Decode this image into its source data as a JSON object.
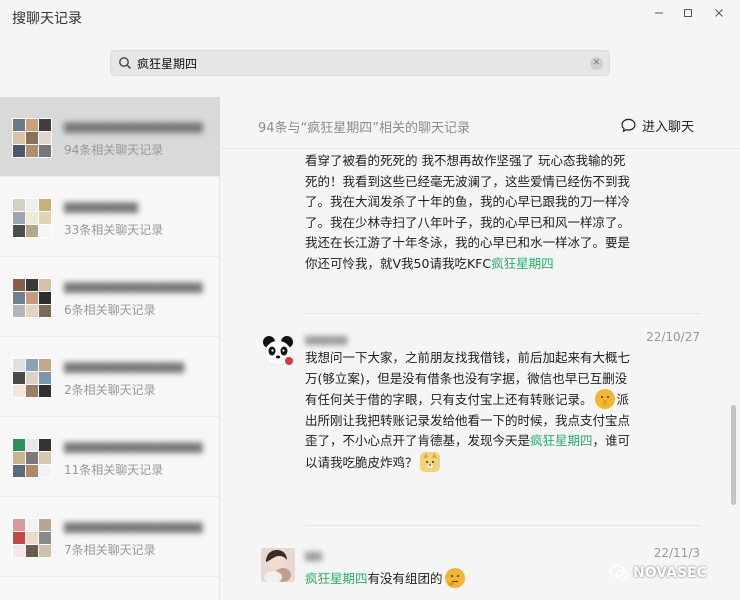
{
  "window": {
    "title": "搜聊天记录"
  },
  "search": {
    "value": "疯狂星期四"
  },
  "sidebar": {
    "items": [
      {
        "count": "94条相关聊天记录",
        "active": true
      },
      {
        "count": "33条相关聊天记录",
        "active": false
      },
      {
        "count": "6条相关聊天记录",
        "active": false
      },
      {
        "count": "2条相关聊天记录",
        "active": false
      },
      {
        "count": "11条相关聊天记录",
        "active": false
      },
      {
        "count": "7条相关聊天记录",
        "active": false
      }
    ]
  },
  "results": {
    "summary": "94条与“疯狂星期四”相关的聊天记录",
    "enter_chat_label": "进入聊天",
    "keyword": "疯狂星期四",
    "messages": [
      {
        "text": "看穿了被看的死死的 我不想再故作坚强了 玩心态我输的死死的！我看到这些已经毫无波澜了，这些爱情已经伤不到我了。我在大润发杀了十年的鱼，我的心早已跟我的刀一样冷了。我在少林寺扫了八年叶子，我的心早已和风一样凉了。我还在长江游了十年冬泳，我的心早已和水一样冰了。要是你还可怜我，就V我50请我吃KFC"
      },
      {
        "date": "22/10/27",
        "text_before": "我想问一下大家，之前朋友找我借钱，前后加起来有大概七万(够立案)，但是没有借条也没有字据，微信也早已互删没有任何关于借的字眼，只有支付宝上还有转账记录。",
        "text_middle": "派出所刚让我把转账记录发给他看一下的时候，我点支付宝点歪了，不小心点开了肯德基，发现今天是",
        "text_after": "，谁可以请我吃脆皮炸鸡？"
      },
      {
        "date": "22/11/3",
        "text_after": "有没有组团的"
      }
    ]
  },
  "watermark": {
    "text": "NOVASEC"
  },
  "colors": {
    "highlight": "#2aae67",
    "active_item": "#d9d9d9"
  }
}
